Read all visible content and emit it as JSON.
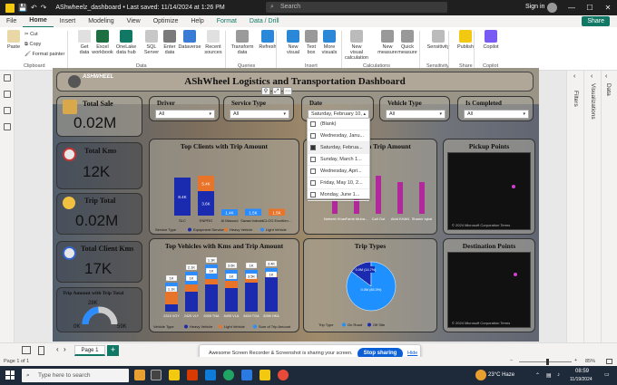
{
  "titlebar": {
    "doc_title": "AShwheelz_dashboard • Last saved: 11/14/2024 at 1:26 PM",
    "search_placeholder": "Search",
    "signin": "Sign in"
  },
  "menu": {
    "tabs": [
      "File",
      "Home",
      "Insert",
      "Modeling",
      "View",
      "Optimize",
      "Help",
      "Format",
      "Data / Drill"
    ],
    "active": "Home",
    "share": "Share"
  },
  "ribbon": {
    "paste": "Paste",
    "cut": "Cut",
    "copy": "Copy",
    "format_painter": "Format painter",
    "clipboard_group": "Clipboard",
    "buttons": [
      {
        "line1": "Get",
        "line2": "data"
      },
      {
        "line1": "Excel",
        "line2": "workbook"
      },
      {
        "line1": "OneLake",
        "line2": "data hub"
      },
      {
        "line1": "SQL",
        "line2": "Server"
      },
      {
        "line1": "Enter",
        "line2": "data"
      },
      {
        "line1": "Dataverse",
        "line2": ""
      },
      {
        "line1": "Recent",
        "line2": "sources"
      },
      {
        "line1": "Transform",
        "line2": "data"
      },
      {
        "line1": "Refresh",
        "line2": ""
      },
      {
        "line1": "New",
        "line2": "visual"
      },
      {
        "line1": "Text",
        "line2": "box"
      },
      {
        "line1": "More",
        "line2": "visuals"
      },
      {
        "line1": "New visual",
        "line2": "calculation"
      },
      {
        "line1": "New",
        "line2": "measure"
      },
      {
        "line1": "Quick",
        "line2": "measure"
      },
      {
        "line1": "Sensitivity",
        "line2": ""
      },
      {
        "line1": "Publish",
        "line2": ""
      },
      {
        "line1": "Copilot",
        "line2": ""
      }
    ],
    "groups": [
      "Data",
      "Queries",
      "Insert",
      "Calculations",
      "Sensitivity",
      "Share",
      "Copilot"
    ]
  },
  "report": {
    "title": "AShWheel Logistics and Transportation Dashboard",
    "logo_text": "ASHWHEEL",
    "kpis": [
      {
        "label": "Total Sale",
        "value": "0.02M"
      },
      {
        "label": "Total Kms",
        "value": "12K"
      },
      {
        "label": "Trip Total",
        "value": "0.02M"
      },
      {
        "label": "Total Client Kms",
        "value": "17K"
      }
    ],
    "slicers": [
      {
        "label": "Driver",
        "value": "All"
      },
      {
        "label": "Service Type",
        "value": "All"
      },
      {
        "label": "Date",
        "value": "Saturday, February 10, 2..."
      },
      {
        "label": "Vehicle Type",
        "value": "All"
      },
      {
        "label": "Is Completed",
        "value": "All"
      }
    ],
    "date_options": [
      {
        "label": "(Blank)",
        "selected": false
      },
      {
        "label": "Wednesday, Janu...",
        "selected": false
      },
      {
        "label": "Saturday, Februa...",
        "selected": true
      },
      {
        "label": "Sunday, March 1...",
        "selected": false
      },
      {
        "label": "Wednesday, Apri...",
        "selected": false
      },
      {
        "label": "Friday, May 10, 2...",
        "selected": false
      },
      {
        "label": "Monday, June 1...",
        "selected": false
      }
    ],
    "gauge": {
      "title": "Trip Amount with Trip Total",
      "value": "28K",
      "min": "0K",
      "max": "59K",
      "fraction": 0.47
    },
    "titles": {
      "top_clients": "Top Clients with Trip Amount",
      "trip_amount_driver": "...ith Trip Amount",
      "pickup": "Pickup Points",
      "top_vehicles": "Top Vehicles with Kms and Trip Amount",
      "trip_types": "Trip Types",
      "destination": "Destination Points"
    },
    "map_credit": "© 2024 Microsoft Corporation  Terms"
  },
  "chart_data": [
    {
      "type": "bar",
      "title": "Top Clients with Trip Amount",
      "categories": [
        "SLC",
        "ENPRO",
        "Al Masoud",
        "Sazaa Industr...",
        "ICLOG Excellen..."
      ],
      "series": [
        {
          "name": "Equipment Service",
          "color": "#1a2bb0",
          "values": [
            8.4,
            5.4,
            0,
            0,
            0
          ]
        },
        {
          "name": "Heavy Vehicle",
          "color": "#e8742a",
          "values": [
            0,
            3.4,
            0,
            0,
            1.5
          ]
        },
        {
          "name": "Light Vehicle",
          "color": "#2a8cff",
          "values": [
            0,
            0,
            1.4,
            1.5,
            0
          ]
        }
      ],
      "data_labels": [
        "8.4K",
        "3.6K",
        "5.4K",
        "1.4K",
        "1.5K",
        "1.5K"
      ]
    },
    {
      "type": "bar",
      "title": "...ith Trip Amount",
      "categories": [
        "Naheeb Khan",
        "Famb Muha...",
        "Call Out",
        "Abid KHAN",
        "Shamir Iqbal"
      ],
      "values": [
        2,
        5,
        6,
        5,
        5
      ],
      "color": "#b0289a"
    },
    {
      "type": "bar",
      "title": "Top Vehicles with Kms and Trip Amount",
      "categories": [
        "2315 VGY",
        "2425 VLY",
        "6305 TNA",
        "8405 VLA",
        "8404 TGA",
        "8396 HKA"
      ],
      "series": [
        {
          "name": "Heavy Vehicle",
          "color": "#1a2bb0"
        },
        {
          "name": "Light Vehicle",
          "color": "#e8742a"
        },
        {
          "name": "Sum of Trip Amount",
          "color": "#2a8cff"
        }
      ],
      "data_labels": [
        "1K",
        "1.1K",
        "2.1K",
        "1K",
        "1.3K",
        "1K",
        "3.6K",
        "1K",
        "1K",
        "3.5K",
        "3.4K",
        "1K"
      ]
    },
    {
      "type": "pie",
      "title": "Trip Types",
      "legend_title": "Trip Type",
      "legend": [
        "On Road",
        "Off Site"
      ],
      "slices": [
        {
          "name": "Off Site",
          "label": "0.0M (14.7%)",
          "value": 14.7,
          "color": "#1a2bb0"
        },
        {
          "name": "On Road",
          "label": "0.0M (85.3%)",
          "value": 85.3,
          "color": "#1e90ff"
        }
      ]
    }
  ],
  "legend_prefix": {
    "service": "Service Type",
    "vehicle": "Vehicle Type"
  },
  "panes": {
    "filters": "Filters",
    "visualizations": "Visualizations",
    "data": "Data"
  },
  "pages": {
    "tab": "Page 1",
    "status": "Page 1 of 1",
    "zoom": "85%"
  },
  "share_banner": {
    "text": "Awesome Screen Recorder & Screenshot is sharing your screen.",
    "stop": "Stop sharing",
    "hide": "Hide"
  },
  "taskbar": {
    "search_placeholder": "Type here to search",
    "weather": "23°C Haze",
    "time": "08:59",
    "date": "11/19/2024"
  }
}
